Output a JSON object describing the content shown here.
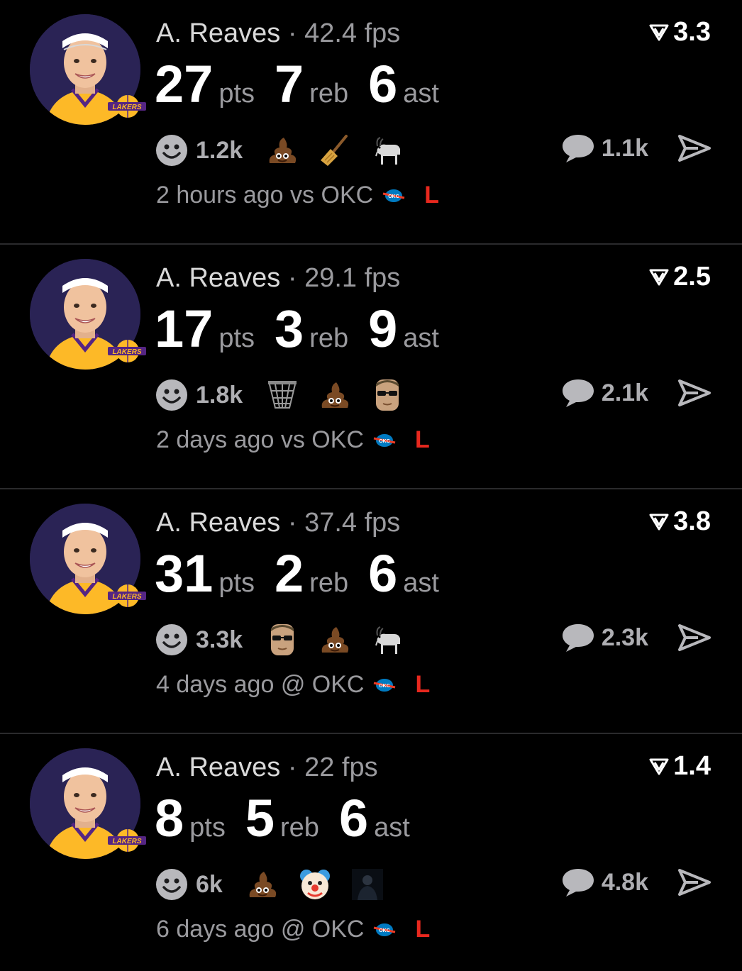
{
  "colors": {
    "background": "#000000",
    "loss": "#e8281e",
    "muted": "#9a9a9e",
    "avatar_bg": "#2a2355",
    "lakers_gold": "#fdb927"
  },
  "posts": [
    {
      "player": "A. Reaves",
      "separator": "·",
      "fps": "42.4 fps",
      "rating": "3.3",
      "stats": [
        {
          "value": "27",
          "label": "pts"
        },
        {
          "value": "7",
          "label": "reb"
        },
        {
          "value": "6",
          "label": "ast"
        }
      ],
      "reaction_count": "1.2k",
      "emojis": [
        "poop-icon",
        "broom-icon",
        "goat-icon"
      ],
      "comment_count": "1.1k",
      "time": "2 hours ago",
      "venue": "vs",
      "opponent": "OKC",
      "result": "L"
    },
    {
      "player": "A. Reaves",
      "separator": "·",
      "fps": "29.1 fps",
      "rating": "2.5",
      "stats": [
        {
          "value": "17",
          "label": "pts"
        },
        {
          "value": "3",
          "label": "reb"
        },
        {
          "value": "9",
          "label": "ast"
        }
      ],
      "reaction_count": "1.8k",
      "emojis": [
        "basketball-net-icon",
        "poop-icon",
        "sunglasses-face-icon"
      ],
      "comment_count": "2.1k",
      "time": "2 days ago",
      "venue": "vs",
      "opponent": "OKC",
      "result": "L"
    },
    {
      "player": "A. Reaves",
      "separator": "·",
      "fps": "37.4 fps",
      "rating": "3.8",
      "stats": [
        {
          "value": "31",
          "label": "pts"
        },
        {
          "value": "2",
          "label": "reb"
        },
        {
          "value": "6",
          "label": "ast"
        }
      ],
      "reaction_count": "3.3k",
      "emojis": [
        "sunglasses-face-icon",
        "poop-icon",
        "goat-icon"
      ],
      "comment_count": "2.3k",
      "time": "4 days ago",
      "venue": "@",
      "opponent": "OKC",
      "result": "L"
    },
    {
      "player": "A. Reaves",
      "separator": "·",
      "fps": "22 fps",
      "rating": "1.4",
      "stats": [
        {
          "value": "8",
          "label": "pts"
        },
        {
          "value": "5",
          "label": "reb"
        },
        {
          "value": "6",
          "label": "ast"
        }
      ],
      "reaction_count": "6k",
      "emojis": [
        "poop-icon",
        "clown-face-icon",
        "dark-figure-icon"
      ],
      "comment_count": "4.8k",
      "time": "6 days ago",
      "venue": "@",
      "opponent": "OKC",
      "result": "L"
    }
  ]
}
